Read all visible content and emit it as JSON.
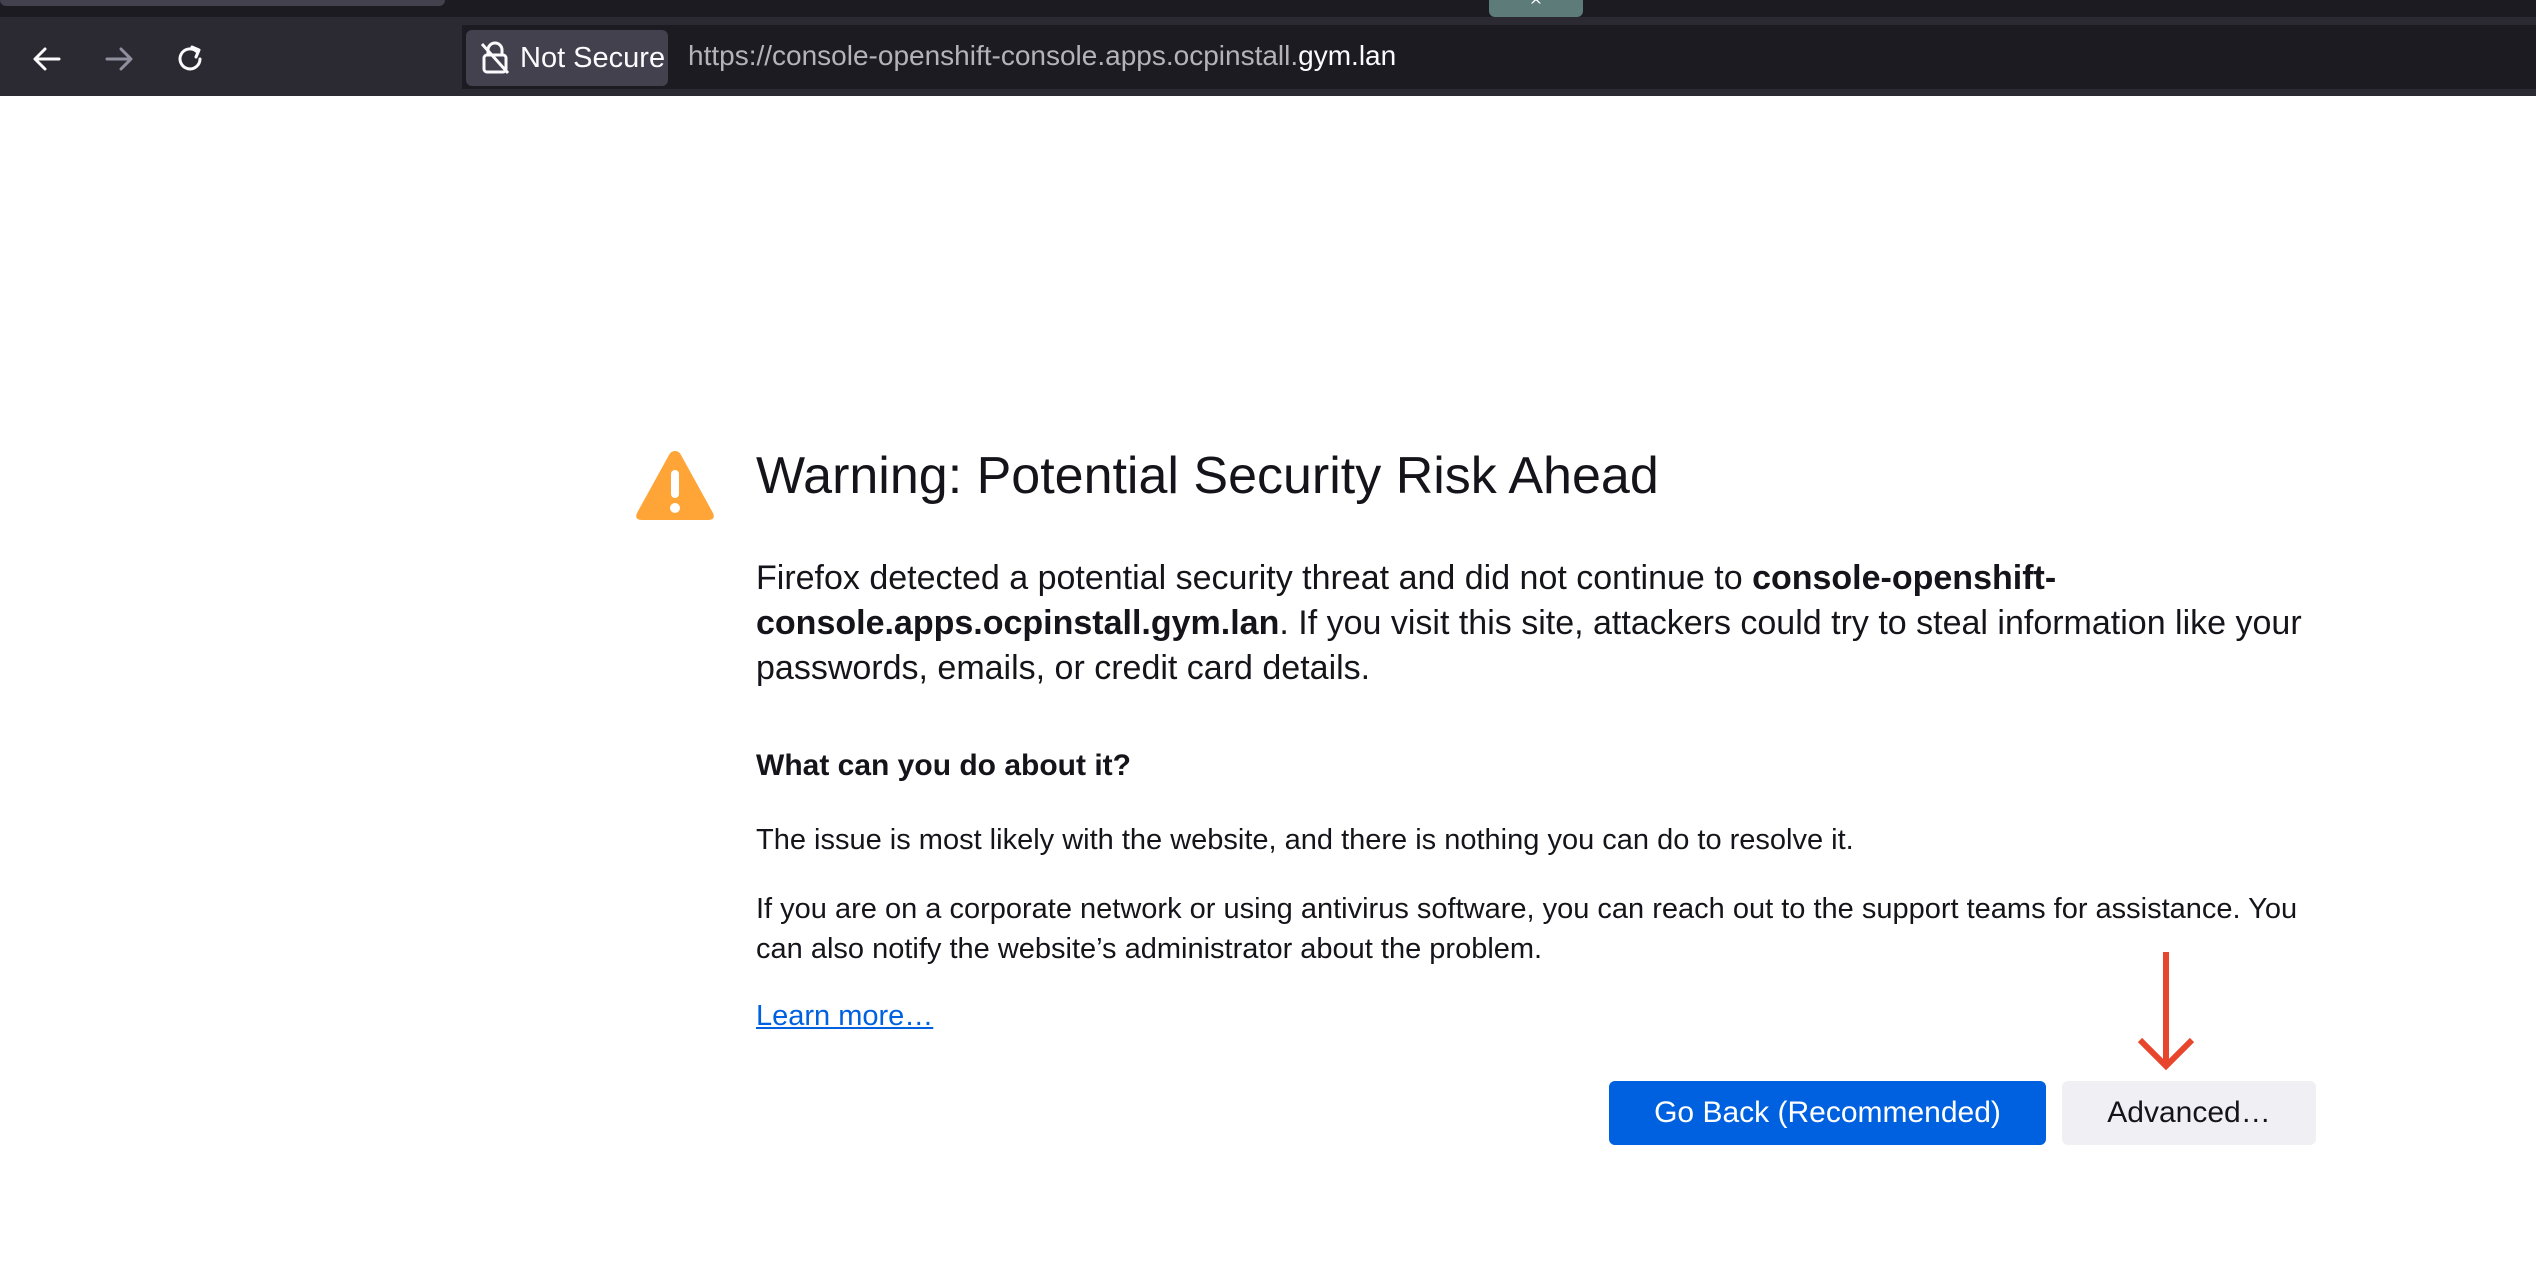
{
  "browser": {
    "collapse_glyph": "^",
    "security_label": "Not Secure",
    "url_prefix": "https://console-openshift-console.apps.ocpinstall.",
    "url_host": "gym.lan",
    "icons": [
      "back-arrow-icon",
      "forward-arrow-icon",
      "reload-icon",
      "insecure-lock-icon"
    ]
  },
  "page": {
    "title": "Warning: Potential Security Risk Ahead",
    "intro_before": "Firefox detected a potential security threat and did not continue to ",
    "intro_host": "console-openshift-console.apps.ocpinstall.gym.lan",
    "intro_after": ". If you visit this site, attackers could try to steal information like your passwords, emails, or credit card details.",
    "subheading": "What can you do about it?",
    "paragraph1": "The issue is most likely with the website, and there is nothing you can do to resolve it.",
    "paragraph2": "If you are on a corporate network or using antivirus software, you can reach out to the support teams for assistance. You can also notify the website’s administrator about the problem.",
    "learn_more": "Learn more…",
    "go_back_button": "Go Back (Recommended)",
    "advanced_button": "Advanced…"
  },
  "colors": {
    "toolbar": "#2b2a33",
    "urlbar": "#1c1b22",
    "primary_button": "#0061e0",
    "warning_icon": "#ffa436",
    "annotation_arrow": "#e8462c"
  }
}
